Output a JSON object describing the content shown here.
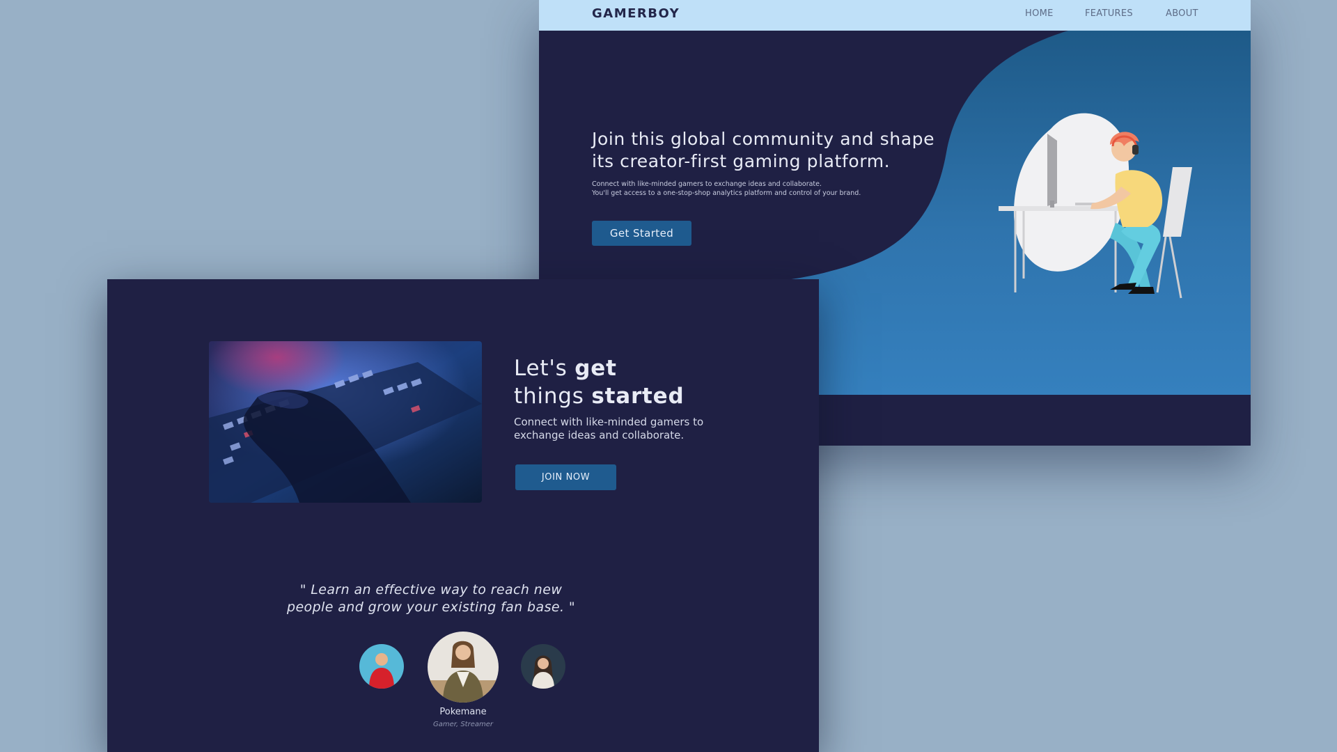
{
  "back_window": {
    "brand": "GAMERBOY",
    "nav": {
      "home": "HOME",
      "features": "FEATURES",
      "about": "ABOUT"
    },
    "hero": {
      "title": "Join this global community and shape its creator-first gaming platform.",
      "subtitle_line1": "Connect with like-minded gamers to exchange ideas and collaborate.",
      "subtitle_line2": "You'll get access to a one-stop-shop analytics platform and control of your brand.",
      "cta_label": "Get Started"
    },
    "illustration_icon": "gamer-at-desk-illustration"
  },
  "front_window": {
    "photo_icon": "keyboard-photo",
    "title_part1": "Let's ",
    "title_bold1": "get",
    "title_part2": "things ",
    "title_bold2": "started",
    "subtitle": "Connect with like-minded gamers to exchange ideas and collaborate.",
    "cta_label": "JOIN NOW",
    "quote": "\" Learn an effective way to reach new people and grow your existing fan base. \"",
    "testimonial": {
      "name": "Pokemane",
      "role": "Gamer, Streamer"
    }
  },
  "colors": {
    "desktop_bg": "#98b0c6",
    "dark_navy": "#1f2044",
    "navbar_bg": "#bfe0f8",
    "button_blue": "#1f5b8f",
    "wave_blue_top": "#1e5a88",
    "wave_blue_bottom": "#3580be"
  }
}
